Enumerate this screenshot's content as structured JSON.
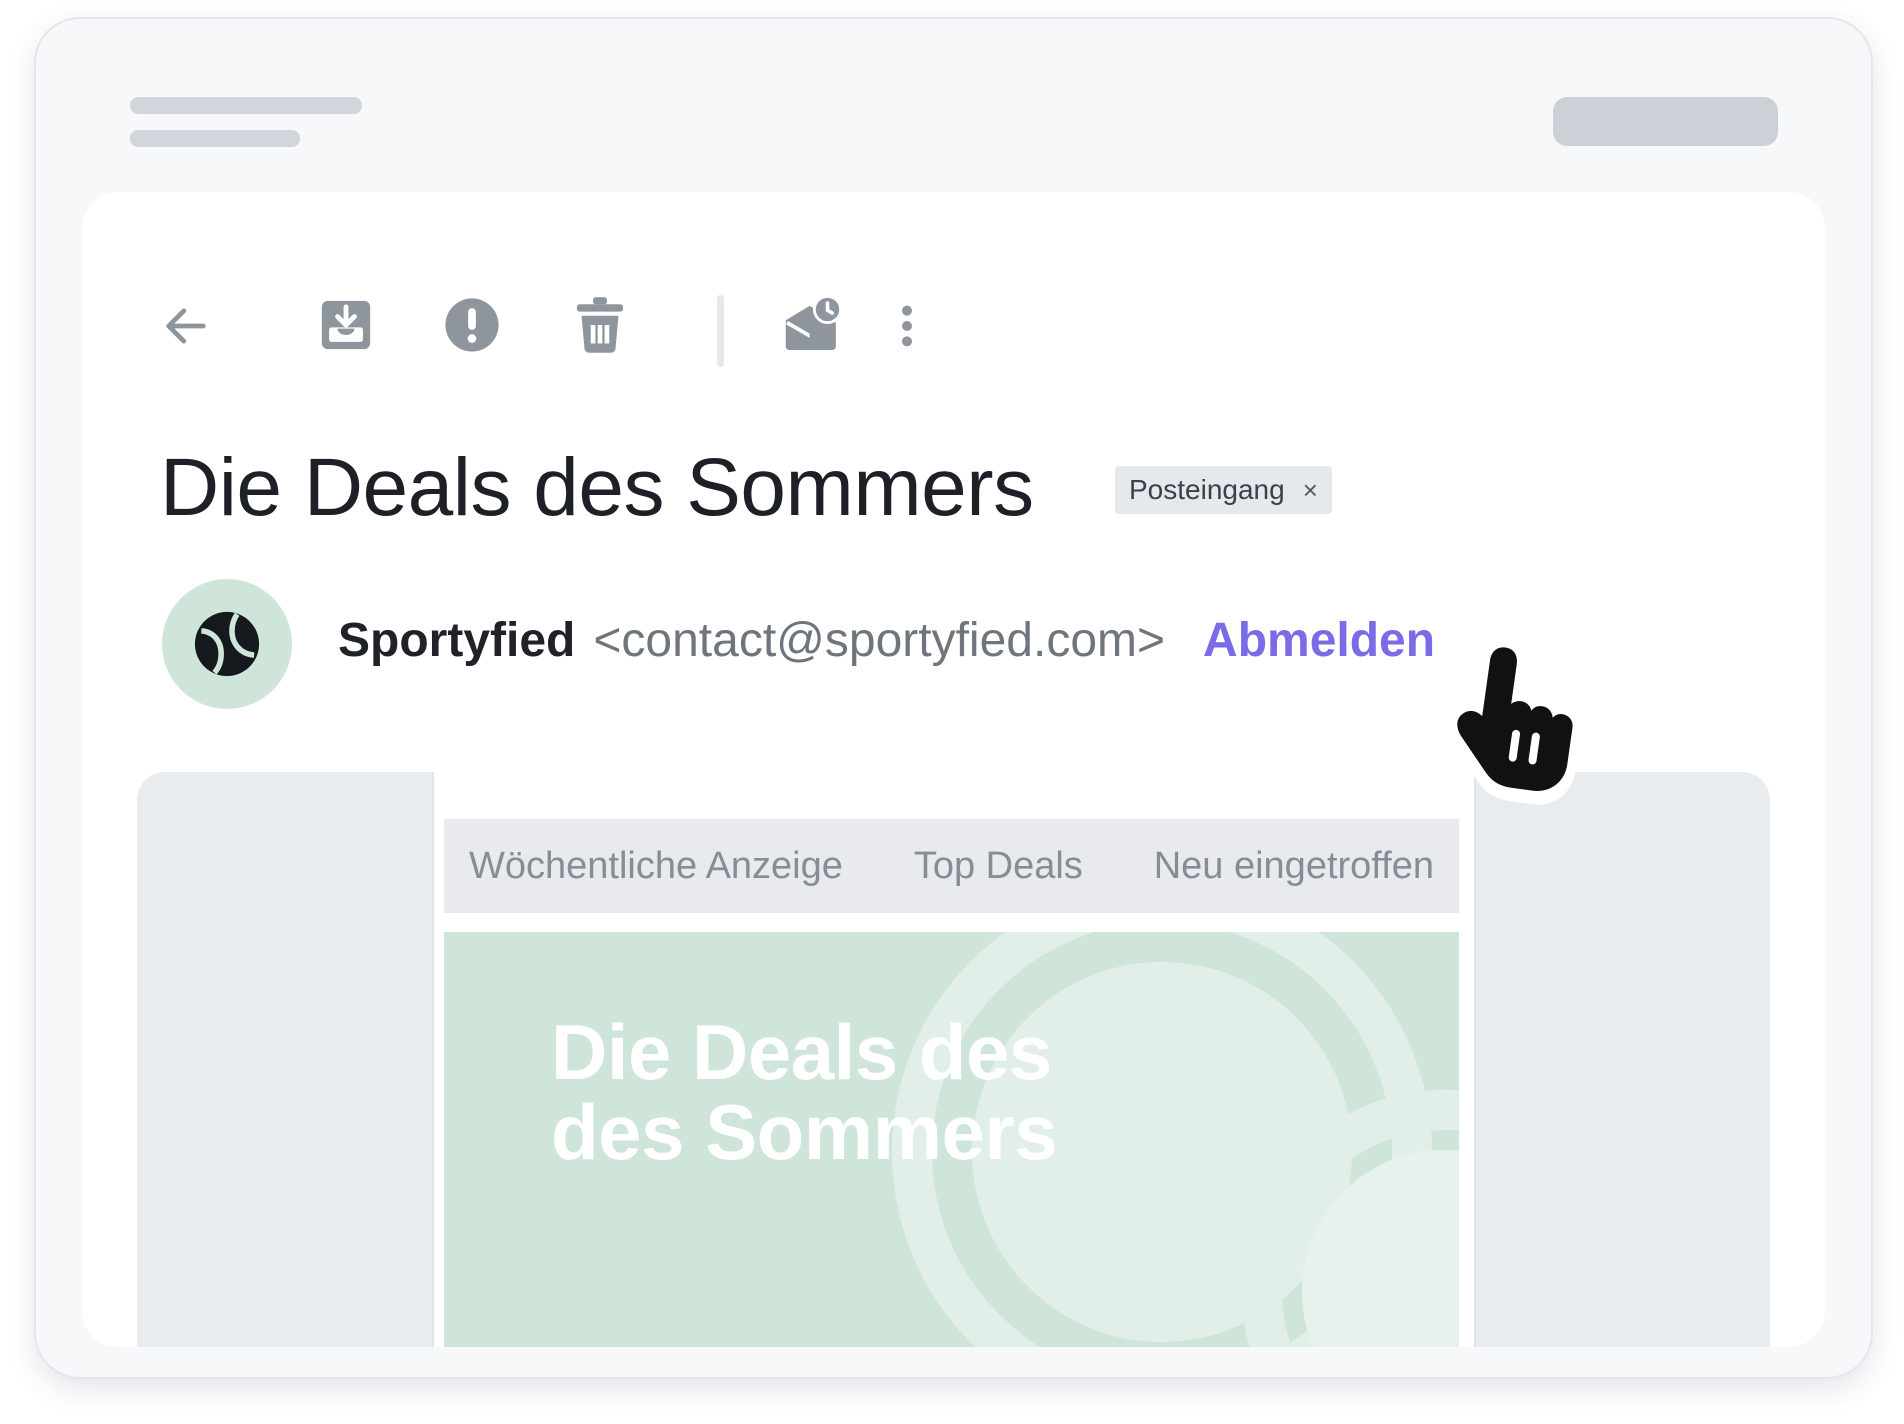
{
  "email": {
    "subject": "Die Deals des Sommers",
    "label": "Posteingang",
    "label_remove": "×",
    "sender_name": "Sportyfied",
    "sender_email": "<contact@sportyfied.com>",
    "unsubscribe": "Abmelden"
  },
  "toolbar": {
    "icons": [
      "back-arrow-icon",
      "archive-icon",
      "report-spam-icon",
      "delete-icon",
      "snooze-icon",
      "more-vert-icon"
    ]
  },
  "newsletter": {
    "nav": [
      "Wöchentliche Anzeige",
      "Top Deals",
      "Neu eingetroffen"
    ],
    "hero_title": "Die Deals des\ndes Sommers"
  },
  "colors": {
    "accent": "#7a6be6",
    "mint": "#cfe5da",
    "icon_gray": "#8e959d",
    "text_dark": "#1d2127"
  }
}
